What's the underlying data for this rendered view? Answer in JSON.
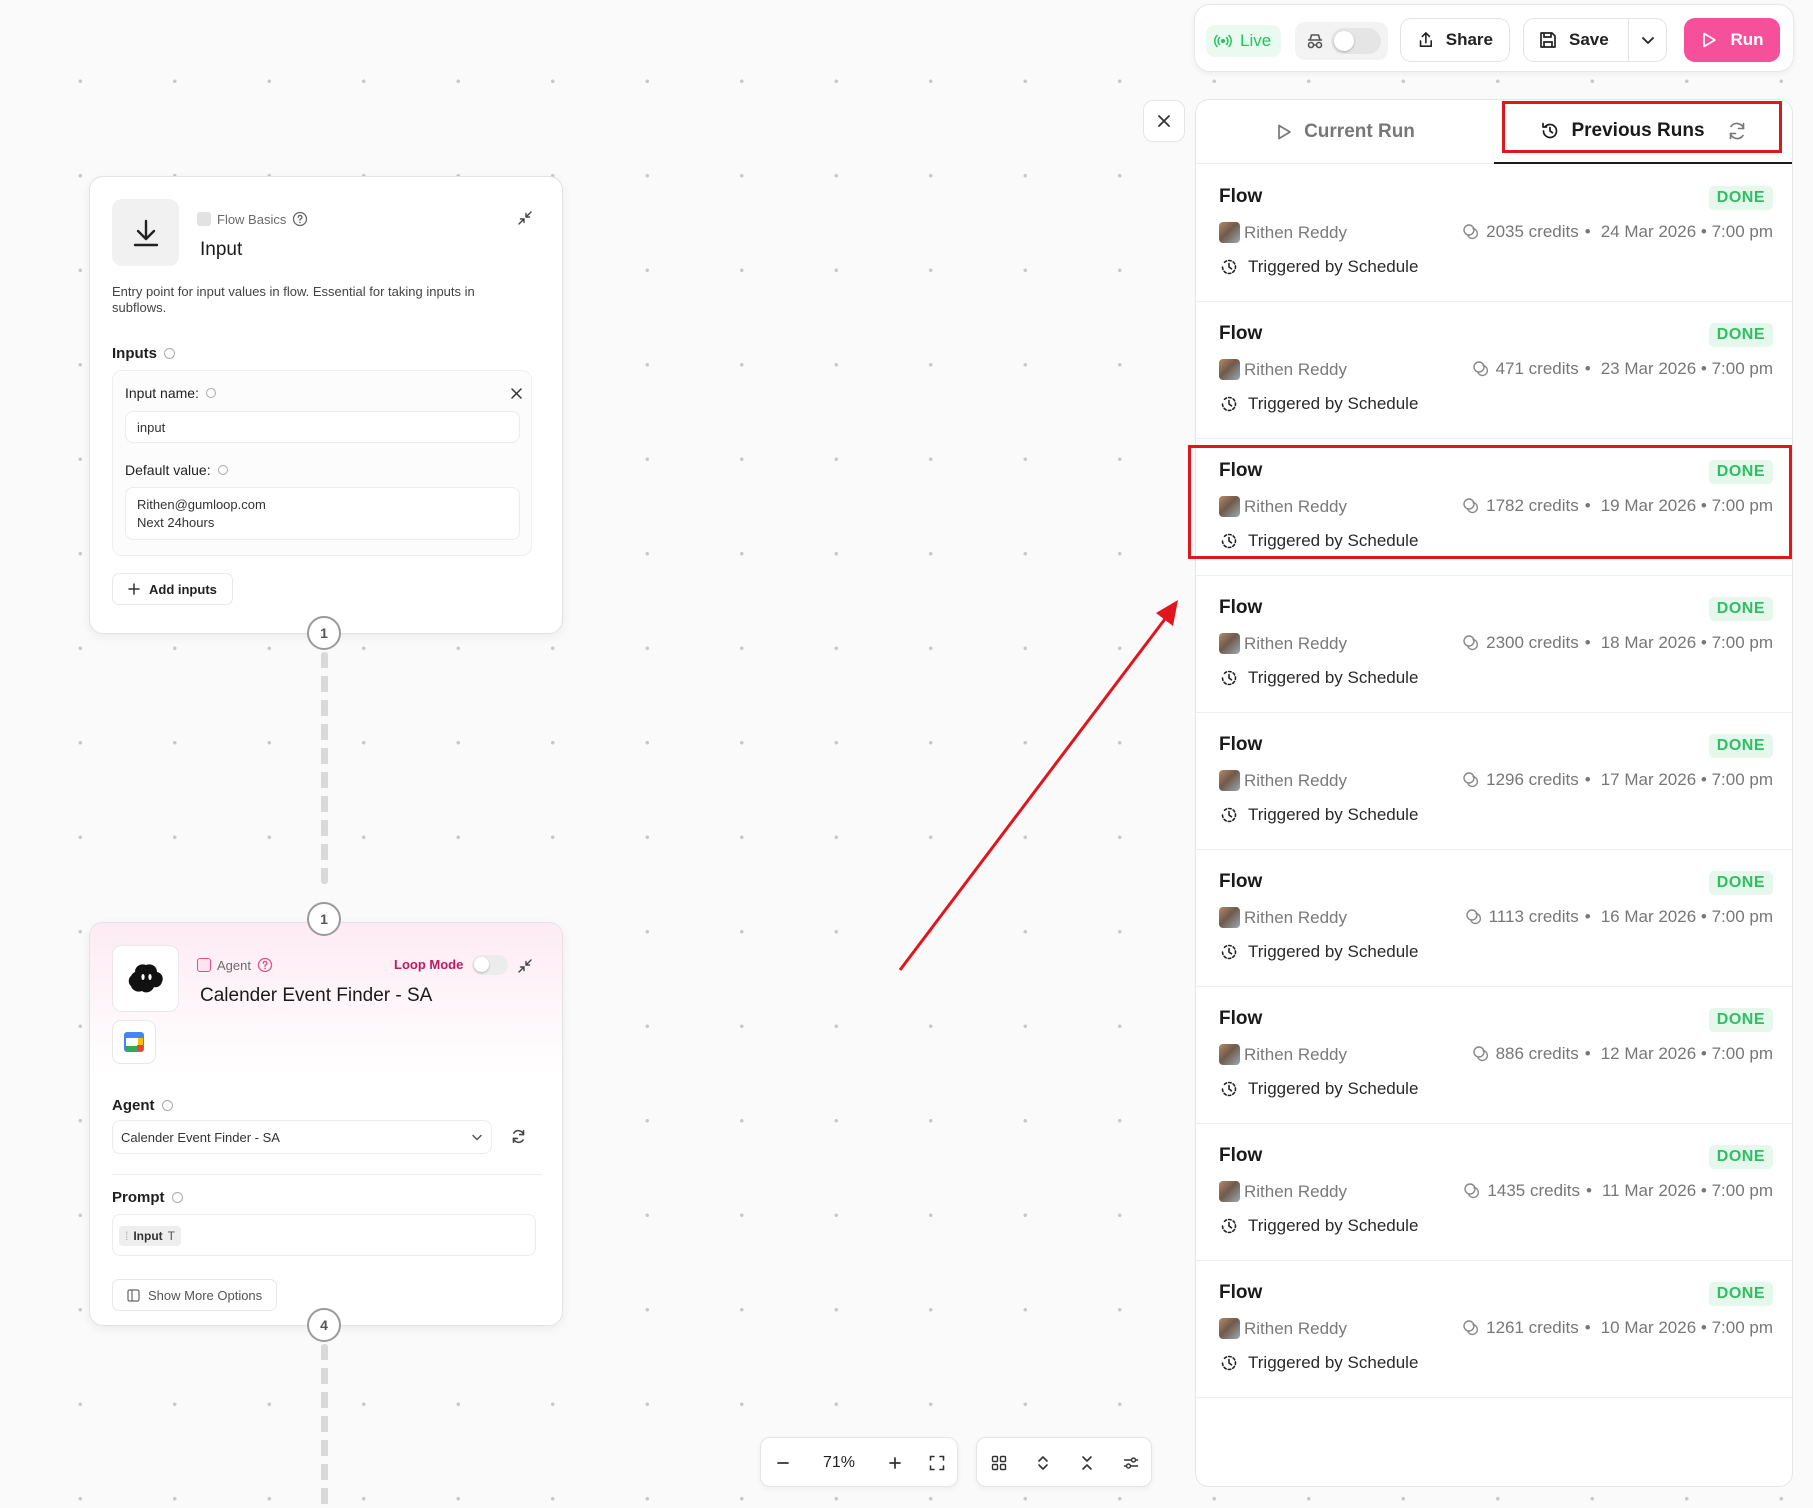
{
  "toolbar": {
    "live_label": "Live",
    "share_label": "Share",
    "save_label": "Save",
    "run_label": "Run"
  },
  "panel": {
    "tab_current": "Current Run",
    "tab_previous": "Previous Runs",
    "runs": [
      {
        "title": "Flow",
        "status": "DONE",
        "user": "Rithen Reddy",
        "credits": "2035 credits",
        "sep": "•",
        "date": "24 Mar 2026 • 7:00 pm",
        "trigger": "Triggered by Schedule"
      },
      {
        "title": "Flow",
        "status": "DONE",
        "user": "Rithen Reddy",
        "credits": "471 credits",
        "sep": "•",
        "date": "23 Mar 2026 • 7:00 pm",
        "trigger": "Triggered by Schedule"
      },
      {
        "title": "Flow",
        "status": "DONE",
        "user": "Rithen Reddy",
        "credits": "1782 credits",
        "sep": "•",
        "date": "19 Mar 2026 • 7:00 pm",
        "trigger": "Triggered by Schedule"
      },
      {
        "title": "Flow",
        "status": "DONE",
        "user": "Rithen Reddy",
        "credits": "2300 credits",
        "sep": "•",
        "date": "18 Mar 2026 • 7:00 pm",
        "trigger": "Triggered by Schedule"
      },
      {
        "title": "Flow",
        "status": "DONE",
        "user": "Rithen Reddy",
        "credits": "1296 credits",
        "sep": "•",
        "date": "17 Mar 2026 • 7:00 pm",
        "trigger": "Triggered by Schedule"
      },
      {
        "title": "Flow",
        "status": "DONE",
        "user": "Rithen Reddy",
        "credits": "1113 credits",
        "sep": "•",
        "date": "16 Mar 2026 • 7:00 pm",
        "trigger": "Triggered by Schedule"
      },
      {
        "title": "Flow",
        "status": "DONE",
        "user": "Rithen Reddy",
        "credits": "886 credits",
        "sep": "•",
        "date": "12 Mar 2026 • 7:00 pm",
        "trigger": "Triggered by Schedule"
      },
      {
        "title": "Flow",
        "status": "DONE",
        "user": "Rithen Reddy",
        "credits": "1435 credits",
        "sep": "•",
        "date": "11 Mar 2026 • 7:00 pm",
        "trigger": "Triggered by Schedule"
      },
      {
        "title": "Flow",
        "status": "DONE",
        "user": "Rithen Reddy",
        "credits": "1261 credits",
        "sep": "•",
        "date": "10 Mar 2026 • 7:00 pm",
        "trigger": "Triggered by Schedule"
      }
    ]
  },
  "input_node": {
    "category": "Flow Basics",
    "title": "Input",
    "description": "Entry point for input values in flow. Essential for taking inputs in subflows.",
    "inputs_label": "Inputs",
    "input_name_label": "Input name:",
    "input_name_value": "input",
    "default_value_label": "Default value:",
    "default_value_line1": "Rithen@gumloop.com",
    "default_value_line2": "Next 24hours",
    "add_inputs_label": "Add inputs",
    "port_bottom": "1"
  },
  "agent_node": {
    "category": "Agent",
    "loop_mode_label": "Loop Mode",
    "title": "Calender Event Finder - SA",
    "agent_label": "Agent",
    "agent_select_value": "Calender Event Finder - SA",
    "prompt_label": "Prompt",
    "prompt_chip": "Input",
    "show_more_label": "Show More Options",
    "port_top": "1",
    "port_bottom": "4"
  },
  "controls": {
    "zoom_level": "71%"
  },
  "colors": {
    "accent_pink": "#f7509b",
    "done_green": "#2fbf63",
    "highlight_red": "#e0161c"
  }
}
